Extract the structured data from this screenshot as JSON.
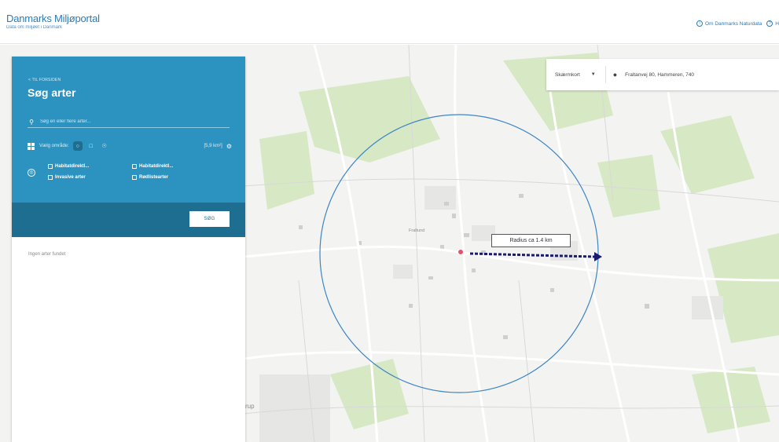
{
  "header": {
    "brand_title": "Danmarks Miljøportal",
    "brand_subtitle": "Data om miljøet i Danmark",
    "link_about": "Om Danmarks Naturdata",
    "link_help": "H"
  },
  "panel": {
    "back_link": "< TIL FORSIDEN",
    "title": "Søg arter",
    "search_placeholder": "Søg en eller flere arter...",
    "area_label": "Vælg område:",
    "area_value": "[5,9 km²]",
    "filters": [
      "Habitatdirektl...",
      "Habitatdirektl...",
      "Invasive arter",
      "Rødlistearter"
    ],
    "search_button": "SØG",
    "results_empty": "Ingen arter fundet"
  },
  "map": {
    "layer_select": "Skærmkort",
    "address": "Fraltanvej 80, Hammeren, 740",
    "village_label": "Fraltund",
    "partial_label": "rup",
    "radius_label": "Radius ca 1.4 km"
  },
  "colors": {
    "panel_blue": "#2c93c1",
    "panel_dark": "#1d6e91",
    "radius_circle": "#3d85c6",
    "radius_arrow": "#1a1a6e",
    "center_dot": "#e8506e"
  },
  "icons": {
    "search": "search-icon",
    "grid": "grid-icon",
    "circle_tool": "circle-tool-icon",
    "polygon_tool": "polygon-tool-icon",
    "point_tool": "point-tool-icon",
    "settings": "gear-icon",
    "target": "target-icon",
    "pin": "map-pin-icon",
    "caret": "caret-down-icon"
  }
}
